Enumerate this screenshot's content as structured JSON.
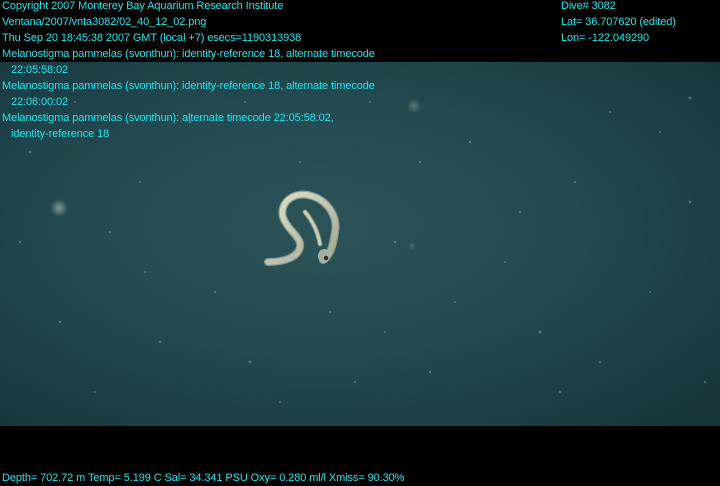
{
  "header": {
    "copyright": "Copyright 2007 Monterey Bay Aquarium Research Institute",
    "file_path": "Ventana/2007/vnta3082/02_40_12_02.png",
    "timestamp": "Thu Sep 20 18:45:38 2007 GMT (local +7)  esecs=1190313938"
  },
  "annotations": [
    {
      "line1": "Melanostigma pammelas (svonthun): identity-reference 18, alternate timecode",
      "line2": "22:05:58:02"
    },
    {
      "line1": "Melanostigma pammelas (svonthun): identity-reference 18, alternate timecode",
      "line2": "22:06:00:02"
    },
    {
      "line1": "Melanostigma pammelas (svonthun): alternate timecode 22:05:58:02,",
      "line2": "identity-reference 18"
    }
  ],
  "dive_info": {
    "dive": "Dive# 3082",
    "lat": "Lat= 36.707620 (edited)",
    "lon": "Lon= -122.049290"
  },
  "sensor_line": "Depth= 702.72 m  Temp= 5.199 C  Sal= 34.341 PSU  Oxy= 0.280 ml/l  Xmiss= 90.30%",
  "colors": {
    "overlay_text": "#23e6ec",
    "water": "#234a50",
    "background": "#000000"
  }
}
